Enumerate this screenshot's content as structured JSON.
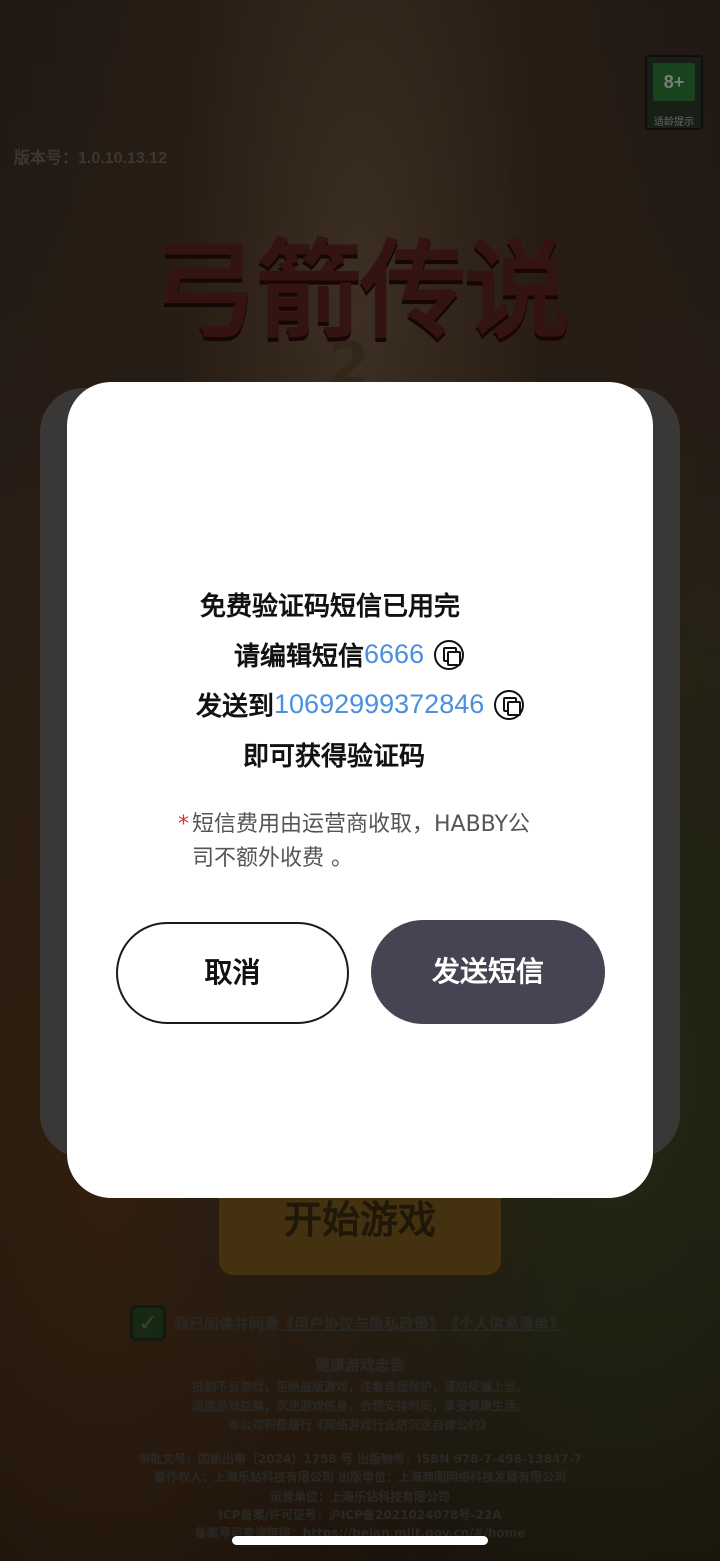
{
  "background": {
    "version": "版本号：1.0.10.13.12",
    "age_rating": {
      "value": "8+",
      "caption": "适龄提示"
    },
    "game_title": "弓箭传说",
    "game_title_sub": "2",
    "start_button": "开始游戏",
    "agreement": {
      "text": "我已阅读并同意",
      "link_privacy": "《用户协议与隐私政策》",
      "link_info": "《个人信息清单》"
    },
    "health_notice": {
      "title": "健康游戏忠告",
      "lines": [
        "抵制不良游戏，拒绝盗版游戏，注意自我保护，谨防受骗上当。",
        "适度游戏益脑，沉迷游戏伤身，合理安排时间，享受健康生活。",
        "本公司积极履行《网络游戏行业防沉迷自律公约》"
      ]
    },
    "legal": [
      "审批文号：国新出审〔2024〕1758 号 出版物号：ISBN 978-7-498-13847-7",
      "著作权人：上海乐钻科技有限公司 出版单位：上海商图网络科技发展有限公司",
      "运营单位：上海乐钻科技有限公司",
      "ICP备案/许可证号：沪ICP备2021024078号-22A",
      "备案号可查询链接：https://beian.miit.gov.cn/#/home"
    ]
  },
  "dialog": {
    "line1": "免费验证码短信已用完",
    "line2_prefix": "请编辑短信",
    "sms_content": "6666",
    "line3_prefix": "发送到",
    "sms_number": "10692999372846",
    "line4": "即可获得验证码",
    "fee_star": "*",
    "fee_line1": "短信费用由运营商收取，HABBY公",
    "fee_line2": "司不额外收费 。",
    "cancel_label": "取消",
    "send_label": "发送短信",
    "accent_color": "#4a8fe0",
    "send_button_color": "#454452"
  }
}
